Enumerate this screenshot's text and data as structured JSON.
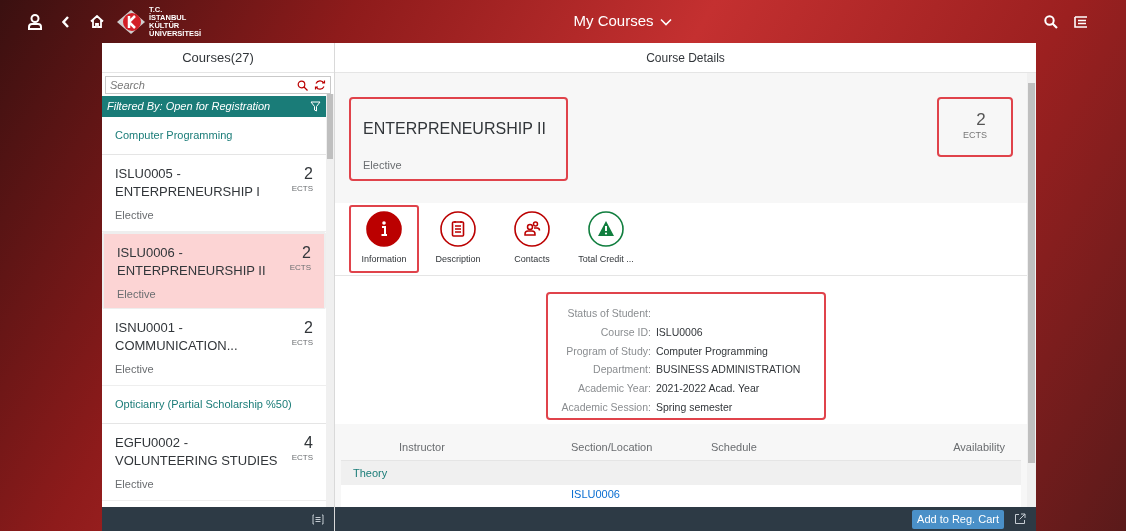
{
  "header": {
    "logo_text": [
      "T.C.",
      "İSTANBUL",
      "KÜLTÜR",
      "ÜNİVERSİTESİ"
    ],
    "title": "My Courses"
  },
  "courses_panel": {
    "title": "Courses(27)",
    "search": {
      "placeholder": "Search"
    },
    "filter": "Filtered By: Open for Registration",
    "items": [
      {
        "kind": "group",
        "label": "Computer Programming"
      },
      {
        "kind": "course",
        "title": "ISLU0005 - ENTERPRENEURSHIP I",
        "ects": "2",
        "unit": "ECTS",
        "type": "Elective",
        "selected": false
      },
      {
        "kind": "course",
        "title": "ISLU0006 - ENTERPRENEURSHIP II",
        "ects": "2",
        "unit": "ECTS",
        "type": "Elective",
        "selected": true
      },
      {
        "kind": "course",
        "title": "ISNU0001 - COMMUNICATION...",
        "ects": "2",
        "unit": "ECTS",
        "type": "Elective",
        "selected": false
      },
      {
        "kind": "group",
        "label": "Opticianry (Partial Scholarship %50)"
      },
      {
        "kind": "course",
        "title": "EGFU0002 - VOLUNTEERING STUDIES",
        "ects": "4",
        "unit": "ECTS",
        "type": "Elective",
        "selected": false
      }
    ]
  },
  "details_panel": {
    "title": "Course Details",
    "course_title": "ENTERPRENEURSHIP II",
    "course_type": "Elective",
    "ects": "2",
    "unit": "ECTS",
    "tabs": [
      {
        "kind": "info",
        "label": "Information",
        "color": "#bb0000",
        "selected": true
      },
      {
        "kind": "description",
        "label": "Description",
        "color": "#bb0000",
        "selected": false
      },
      {
        "kind": "contacts",
        "label": "Contacts",
        "color": "#bb0000",
        "selected": false
      },
      {
        "kind": "warning",
        "label": "Total Credit ...",
        "color": "#107e3e",
        "selected": false
      }
    ],
    "info": [
      {
        "label": "Status of Student:"
      },
      {
        "label": "Course ID:",
        "value": "ISLU0006"
      },
      {
        "label": "Program of Study:",
        "value": "Computer Programming"
      },
      {
        "label": "Department:",
        "value": "BUSINESS ADMINISTRATION"
      },
      {
        "label": "Academic Year:",
        "value": "2021-2022 Acad. Year"
      },
      {
        "label": "Academic Session:",
        "value": "Spring semester"
      }
    ],
    "table": {
      "columns": [
        "Instructor",
        "Section/Location",
        "Schedule",
        "Availability"
      ],
      "group": "Theory",
      "rows": [
        {
          "section": "ISLU0006"
        }
      ]
    }
  },
  "footer": {
    "button": "Add to Reg. Cart"
  }
}
